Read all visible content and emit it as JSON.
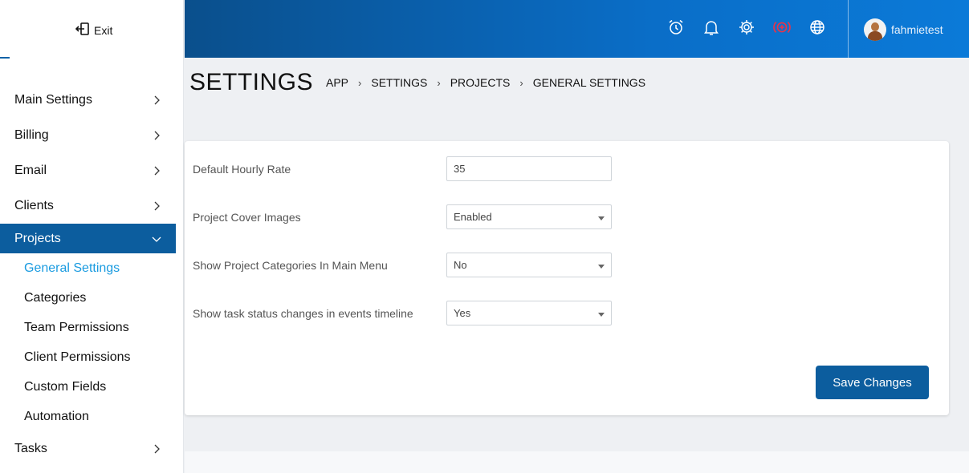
{
  "sidebar": {
    "exit_label": "Exit",
    "items": [
      {
        "label": "Main Settings"
      },
      {
        "label": "Billing"
      },
      {
        "label": "Email"
      },
      {
        "label": "Clients"
      },
      {
        "label": "Projects"
      }
    ],
    "submenu": [
      {
        "label": "General Settings"
      },
      {
        "label": "Categories"
      },
      {
        "label": "Team Permissions"
      },
      {
        "label": "Client Permissions"
      },
      {
        "label": "Custom Fields"
      },
      {
        "label": "Automation"
      }
    ],
    "tasks_label": "Tasks"
  },
  "topbar": {
    "icons": [
      "alarm-clock-icon",
      "bell-icon",
      "gear-icon",
      "add-circle-icon",
      "globe-icon"
    ],
    "username": "fahmietest",
    "colors": {
      "accent": "#0a6ec8",
      "add_icon": "#e8334a"
    }
  },
  "header": {
    "title": "SETTINGS",
    "breadcrumb": [
      "APP",
      "SETTINGS",
      "PROJECTS",
      "GENERAL SETTINGS"
    ]
  },
  "form": {
    "hourly_rate": {
      "label": "Default Hourly Rate",
      "value": "35"
    },
    "cover_images": {
      "label": "Project Cover Images",
      "value": "Enabled"
    },
    "categories_menu": {
      "label": "Show Project Categories In Main Menu",
      "value": "No"
    },
    "task_status": {
      "label": "Show task status changes in events timeline",
      "value": "Yes"
    },
    "save_label": "Save Changes"
  }
}
